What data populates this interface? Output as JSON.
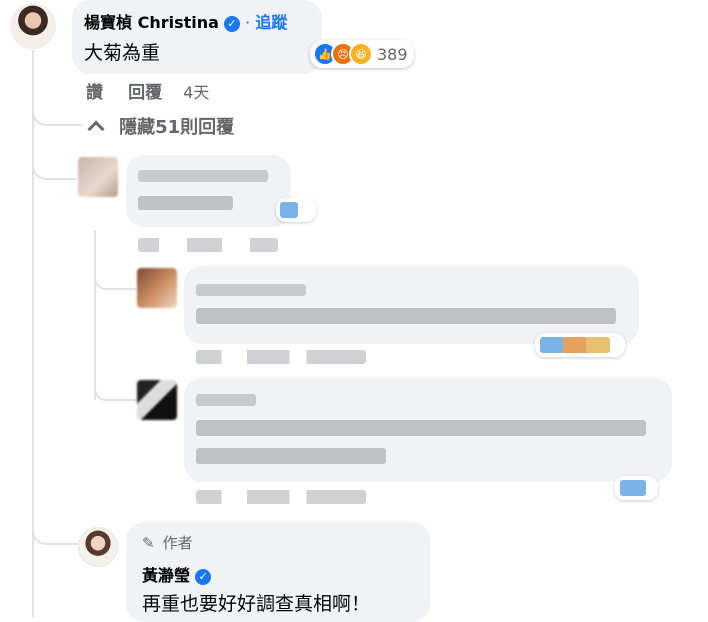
{
  "top_comment": {
    "author": "楊寶楨 Christina",
    "verified": true,
    "separator": "·",
    "follow_label": "追蹤",
    "text": "大菊為重",
    "reaction_count": "389",
    "reaction_icons": [
      "like-icon",
      "angry-icon",
      "haha-icon"
    ],
    "actions": {
      "like": "讚",
      "reply": "回覆",
      "time": "4天"
    }
  },
  "hide_replies": {
    "label": "隱藏51則回覆"
  },
  "author_reply": {
    "badge": "作者",
    "author": "黃瀞瑩",
    "verified": true,
    "text": "再重也要好好調查真相啊！"
  },
  "colors": {
    "accent": "#1877f2",
    "bubble": "#f0f2f5",
    "muted": "#65676b",
    "thread_line": "#dfe1e5"
  }
}
